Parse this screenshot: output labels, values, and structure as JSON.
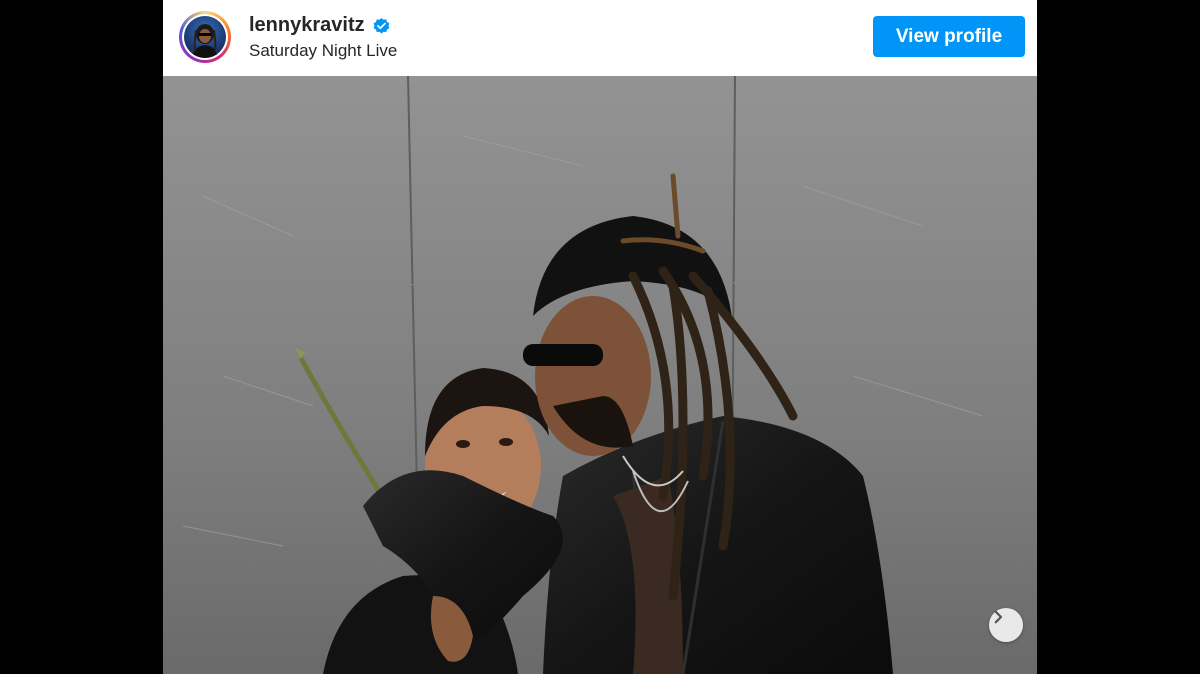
{
  "post": {
    "username": "lennykravitz",
    "location": "Saturday Night Live",
    "view_profile_label": "View profile",
    "verified_icon": "verified-badge-icon",
    "next_icon": "chevron-right-icon",
    "avatar_icon": "profile-avatar"
  },
  "colors": {
    "button_blue": "#0095f6",
    "verified_blue": "#0095f6",
    "text": "#262626",
    "background": "#000000"
  }
}
